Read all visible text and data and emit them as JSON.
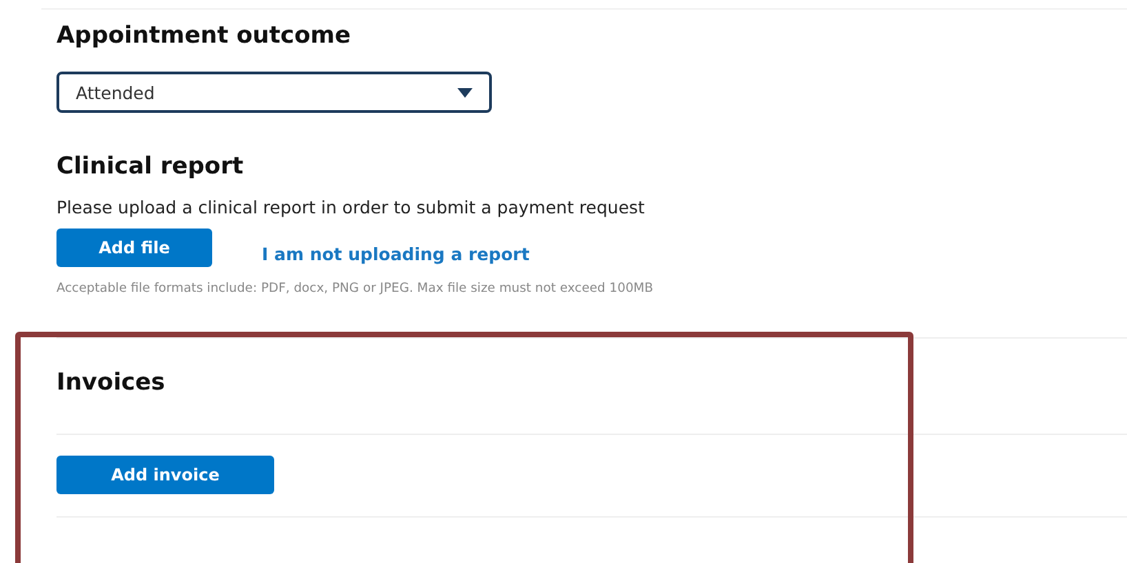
{
  "appointment_outcome": {
    "heading": "Appointment outcome",
    "select": {
      "value": "Attended"
    }
  },
  "clinical_report": {
    "heading": "Clinical report",
    "instruction": "Please upload a clinical report in order to submit a payment request",
    "add_button": "Add file",
    "skip_link": "I am not uploading a report",
    "note": "Acceptable file formats include: PDF, docx, PNG or JPEG. Max file size must not exceed 100MB"
  },
  "invoices": {
    "heading": "Invoices",
    "add_button": "Add invoice"
  }
}
